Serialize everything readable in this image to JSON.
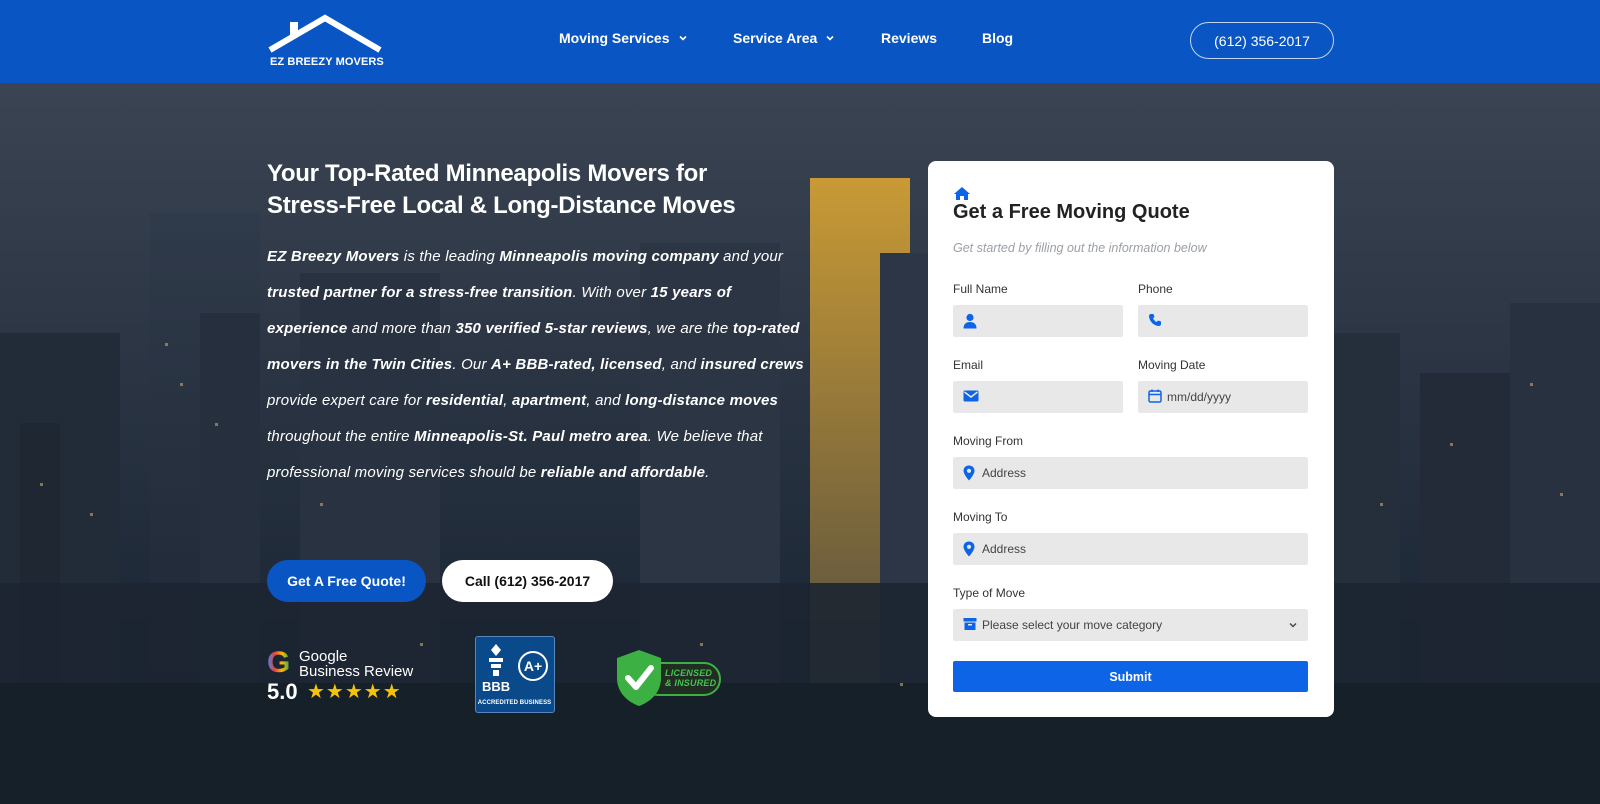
{
  "header": {
    "logo_text": "EZ BREEZY MOVERS",
    "nav": [
      {
        "label": "Moving Services",
        "dropdown": true
      },
      {
        "label": "Service Area",
        "dropdown": true
      },
      {
        "label": "Reviews",
        "dropdown": false
      },
      {
        "label": "Blog",
        "dropdown": false
      }
    ],
    "phone": "(612) 356-2017"
  },
  "hero": {
    "title_line1": "Your Top-Rated Minneapolis Movers for",
    "title_line2": "Stress-Free Local & Long-Distance Moves",
    "body_segments": [
      {
        "text": "EZ Breezy Movers",
        "bold": true
      },
      {
        "text": " is the leading ",
        "bold": false
      },
      {
        "text": "Minneapolis moving company",
        "bold": true
      },
      {
        "text": " and your ",
        "bold": false
      },
      {
        "text": "trusted partner for a stress-free transition",
        "bold": true
      },
      {
        "text": ". With over ",
        "bold": false
      },
      {
        "text": "15 years of experience",
        "bold": true
      },
      {
        "text": " and more than ",
        "bold": false
      },
      {
        "text": "350 verified 5-star reviews",
        "bold": true
      },
      {
        "text": ", we are the ",
        "bold": false
      },
      {
        "text": "top-rated movers in the Twin Cities",
        "bold": true
      },
      {
        "text": ". Our ",
        "bold": false
      },
      {
        "text": "A+ BBB-rated, licensed",
        "bold": true
      },
      {
        "text": ", and ",
        "bold": false
      },
      {
        "text": "insured crews",
        "bold": true
      },
      {
        "text": " provide expert care for ",
        "bold": false
      },
      {
        "text": "residential",
        "bold": true
      },
      {
        "text": ", ",
        "bold": false
      },
      {
        "text": "apartment",
        "bold": true
      },
      {
        "text": ", and ",
        "bold": false
      },
      {
        "text": "long-distance moves",
        "bold": true
      },
      {
        "text": " throughout the entire ",
        "bold": false
      },
      {
        "text": "Minneapolis-St. Paul metro area",
        "bold": true
      },
      {
        "text": ". We believe that professional moving services should be ",
        "bold": false
      },
      {
        "text": "reliable and affordable",
        "bold": true
      },
      {
        "text": ".",
        "bold": false
      }
    ],
    "cta_primary": "Get A Free Quote!",
    "cta_secondary": "Call (612) 356-2017"
  },
  "badges": {
    "google": {
      "g": "G",
      "name": "Google",
      "subtitle": "Business Review",
      "score": "5.0",
      "stars": "★★★★★",
      "rating": 5
    },
    "bbb": {
      "letters": "BBB",
      "grade": "A+",
      "accredited": "ACCREDITED BUSINESS"
    },
    "licensed": {
      "line1": "LICENSED",
      "line2": "& INSURED"
    }
  },
  "form": {
    "title": "Get a Free Moving Quote",
    "subtitle": "Get started by filling out the information below",
    "full_name_label": "Full Name",
    "phone_label": "Phone",
    "email_label": "Email",
    "moving_date_label": "Moving Date",
    "moving_date_placeholder": "mm/dd/yyyy",
    "moving_from_label": "Moving From",
    "moving_from_placeholder": "Address",
    "moving_to_label": "Moving To",
    "moving_to_placeholder": "Address",
    "type_label": "Type of Move",
    "type_placeholder": "Please select your move category",
    "submit": "Submit"
  },
  "colors": {
    "brand_blue": "#0a55c4",
    "submit_blue": "#0d64e6",
    "star_yellow": "#f6c20a",
    "license_green": "#3cb043",
    "input_bg": "#e8e8e8"
  }
}
